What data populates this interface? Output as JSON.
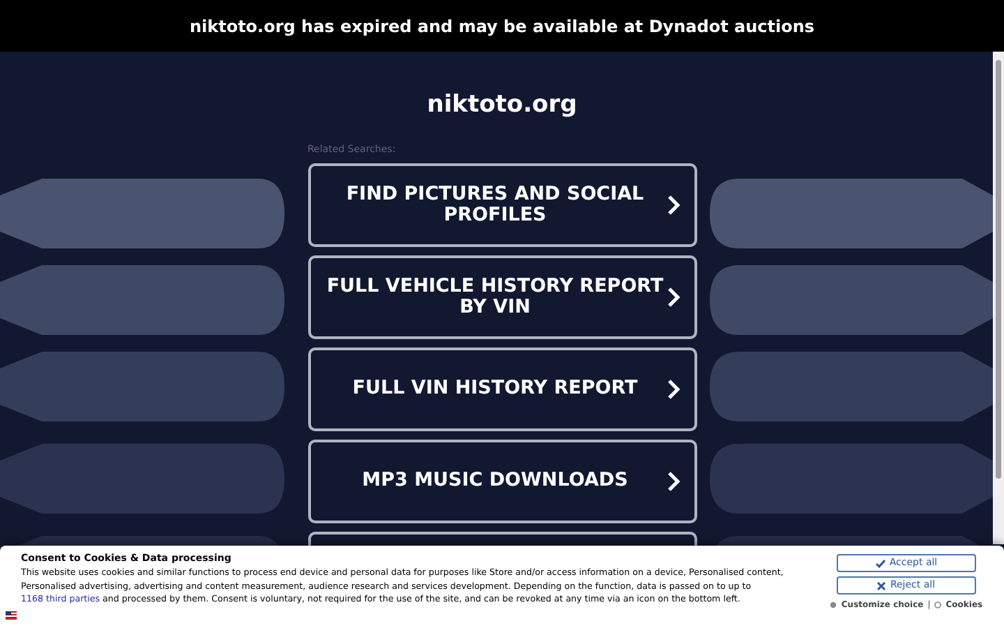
{
  "top_banner": {
    "text": "niktoto.org has expired and may be available at Dynadot auctions"
  },
  "site_title": "niktoto.org",
  "related_label": "Related Searches:",
  "searches": [
    {
      "label": "FIND PICTURES AND SOCIAL PROFILES"
    },
    {
      "label": "FULL VEHICLE HISTORY REPORT BY VIN"
    },
    {
      "label": "FULL VIN HISTORY REPORT"
    },
    {
      "label": "MP3 MUSIC DOWNLOADS"
    }
  ],
  "consent": {
    "title": "Consent to Cookies & Data processing",
    "text_before": "This website uses cookies and similar functions to process end device and personal data for purposes like Store and/or access information on a device, Personalised content, Personalised advertising, advertising and content measurement, audience research and services development. Depending on the function, data is passed on to up to",
    "link": "1168 third parties",
    "text_after": "and processed by them. Consent is voluntary, not required for the use of the site, and can be revoked at any time via an icon on the bottom left.",
    "accept": "Accept all",
    "reject": "Reject all",
    "customize": "Customize choice",
    "separator": "|",
    "cookies": "Cookies"
  }
}
